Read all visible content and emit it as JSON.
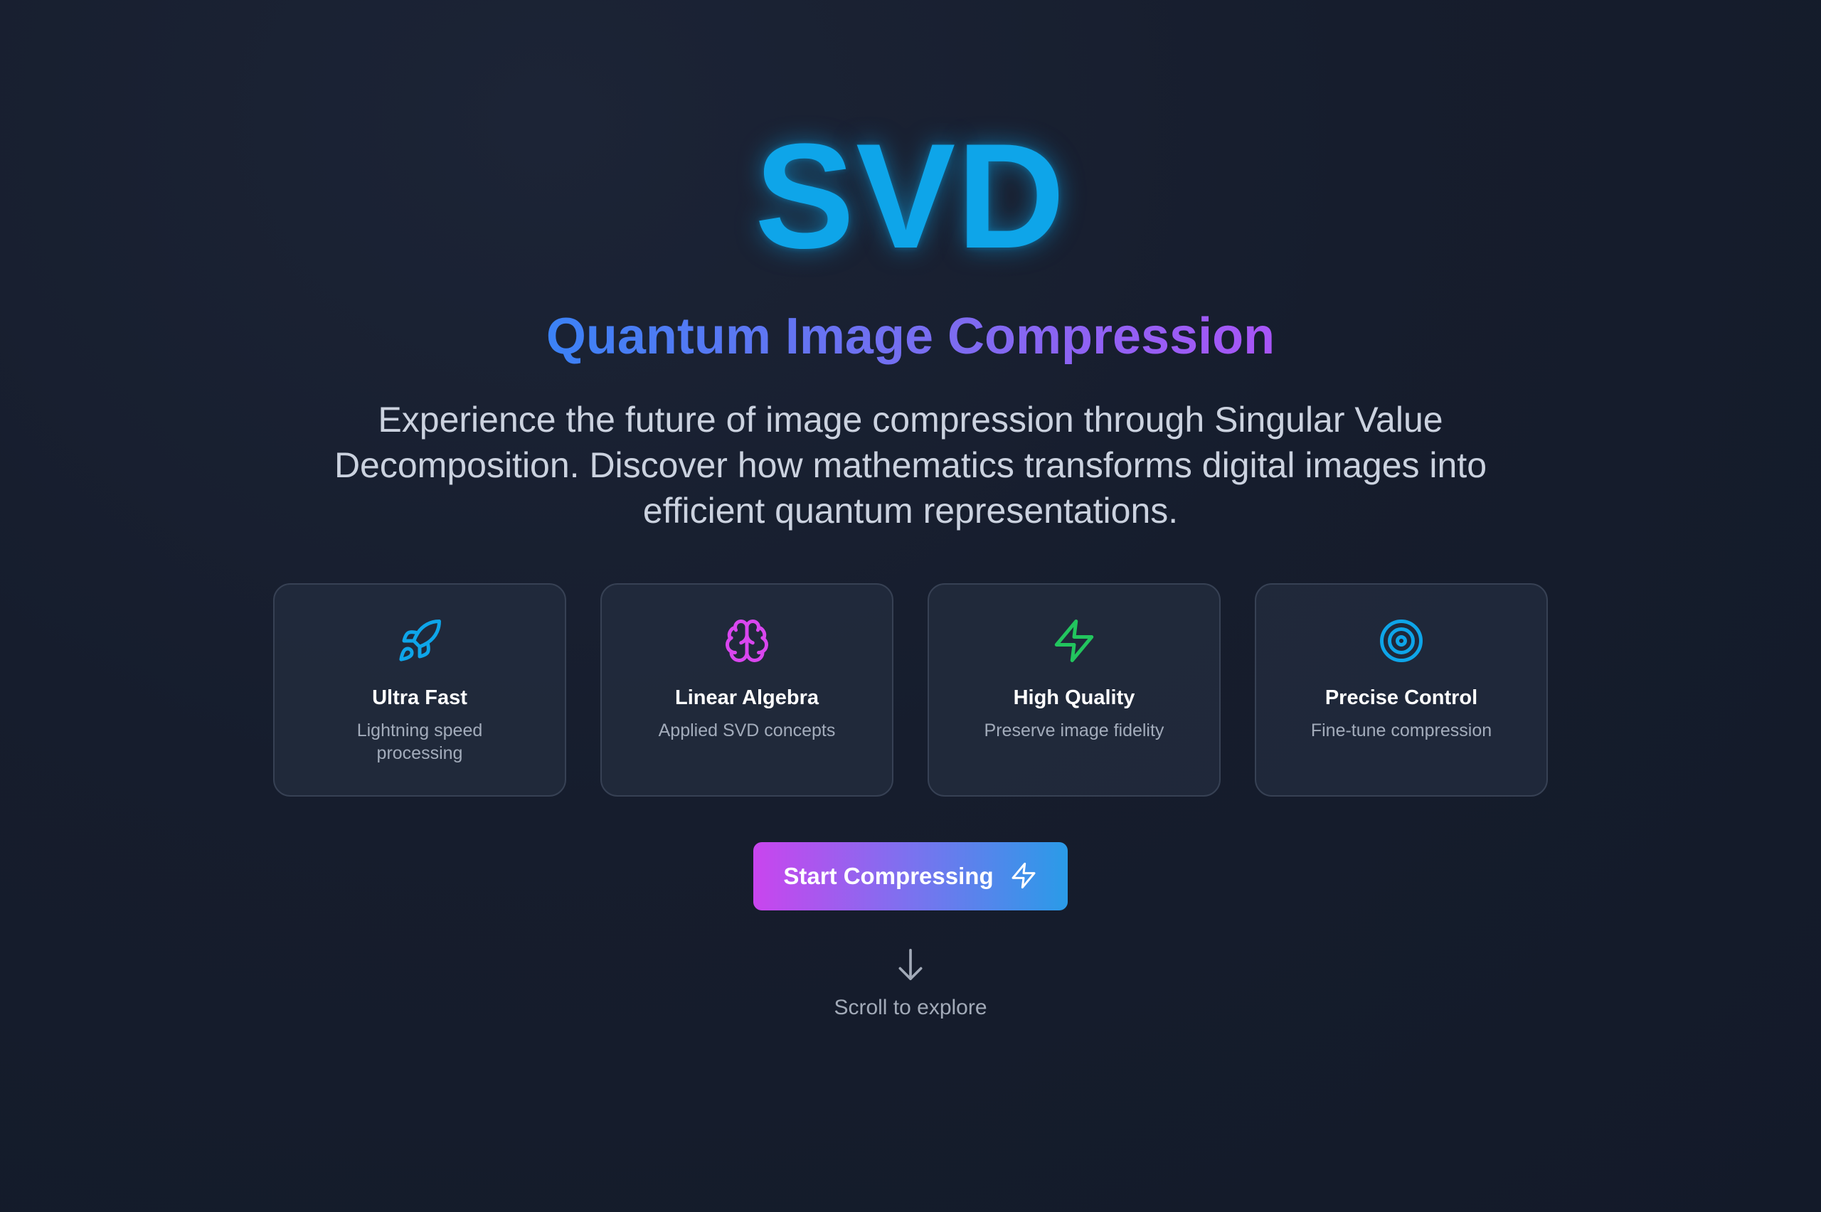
{
  "hero": {
    "logo": "SVD",
    "subtitle": "Quantum Image Compression",
    "description": "Experience the future of image compression through Singular Value Decomposition. Discover how mathematics transforms digital images into efficient quantum representations."
  },
  "features": [
    {
      "icon": "rocket-icon",
      "color": "#0ea5e9",
      "title": "Ultra Fast",
      "subtitle": "Lightning speed processing"
    },
    {
      "icon": "brain-icon",
      "color": "#d946ef",
      "title": "Linear Algebra",
      "subtitle": "Applied SVD concepts"
    },
    {
      "icon": "lightning-icon",
      "color": "#22c55e",
      "title": "High Quality",
      "subtitle": "Preserve image fidelity"
    },
    {
      "icon": "target-icon",
      "color": "#0ea5e9",
      "title": "Precise Control",
      "subtitle": "Fine-tune compression"
    }
  ],
  "cta": {
    "label": "Start Compressing",
    "icon": "lightning-icon"
  },
  "scroll": {
    "icon": "arrow-down-icon",
    "label": "Scroll to explore"
  },
  "colors": {
    "background": "#161d2d",
    "logo": "#0ea5e9",
    "subtitle_gradient": [
      "#3b82f6",
      "#a855f7"
    ],
    "cta_gradient": [
      "#c945ee",
      "#2a9be8"
    ]
  }
}
